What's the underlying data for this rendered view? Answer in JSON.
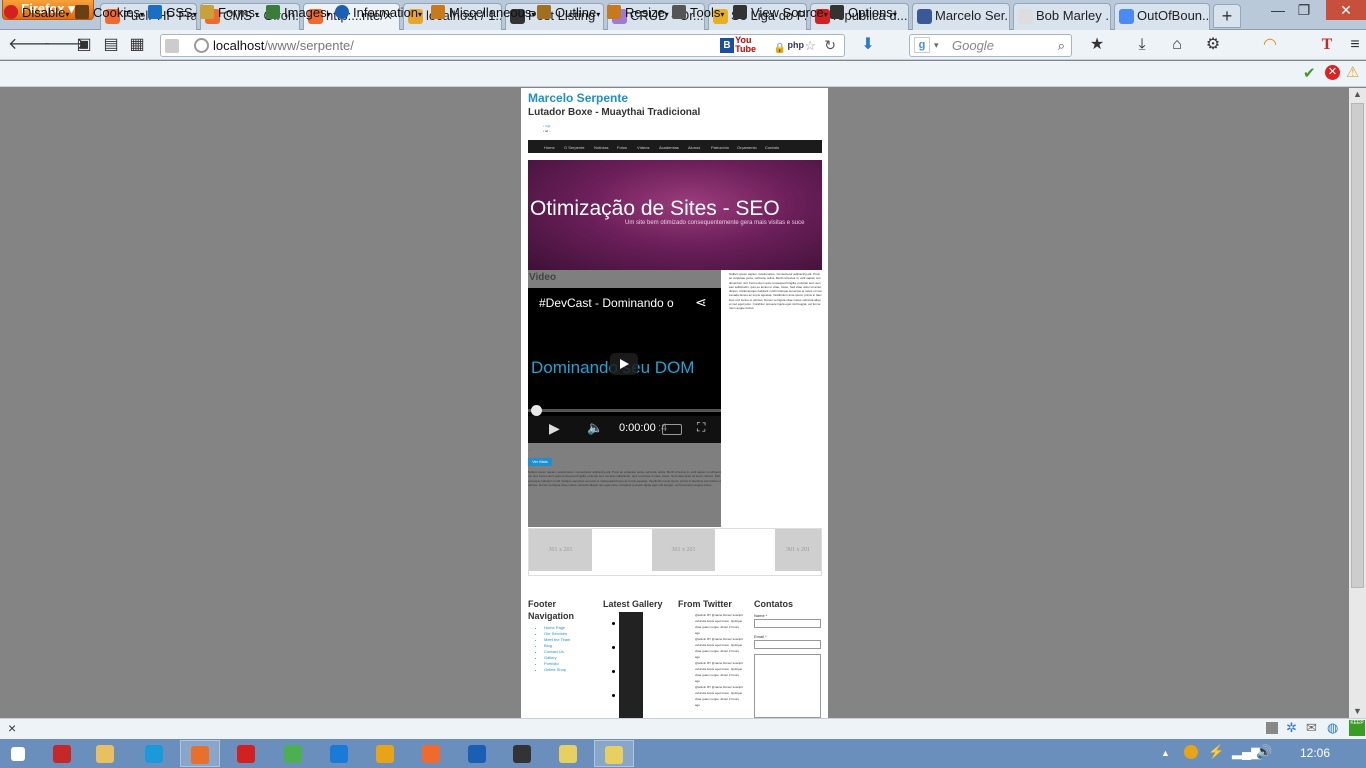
{
  "browser": {
    "app_button": "Firefox",
    "tabs": [
      {
        "label": "FuelPHP Fra...",
        "icon": "xampp-icon",
        "color": "#f06a2d"
      },
      {
        "label": "CMS - Giroh...",
        "icon": "xampp-icon",
        "color": "#f06a2d"
      },
      {
        "label": "http:...nte/",
        "icon": "xampp-icon",
        "color": "#f06a2d",
        "active": true
      },
      {
        "label": "localhost / 1...",
        "icon": "phpmyadmin-icon",
        "color": "#e7a52a"
      },
      {
        "label": "Post Listing",
        "icon": "codepen-icon",
        "color": "#333333"
      },
      {
        "label": "CRUD - Or...",
        "icon": "drop-icon",
        "color": "#9c7ad6"
      },
      {
        "label": "Se Liga do P...",
        "icon": "bird-icon",
        "color": "#e8b020"
      },
      {
        "label": "republica d...",
        "icon": "youtube-icon",
        "color": "#d32020"
      },
      {
        "label": "Marcelo Ser...",
        "icon": "facebook-icon",
        "color": "#3b5998"
      },
      {
        "label": "Bob Marley ...",
        "icon": "page-icon",
        "color": "#dddddd"
      },
      {
        "label": "OutOfBoun...",
        "icon": "google-icon",
        "color": "#4a8af4"
      }
    ],
    "url_host": "localhost",
    "url_path": "/www/serpente/",
    "search_engine": "Google",
    "search_placeholder": "Google"
  },
  "webdev_toolbar": [
    {
      "label": "Disable",
      "icon": "disable-icon"
    },
    {
      "label": "Cookies",
      "icon": "cookies-icon"
    },
    {
      "label": "CSS",
      "icon": "css-icon"
    },
    {
      "label": "Forms",
      "icon": "forms-icon"
    },
    {
      "label": "Images",
      "icon": "images-icon"
    },
    {
      "label": "Information",
      "icon": "information-icon"
    },
    {
      "label": "Miscellaneous",
      "icon": "miscellaneous-icon"
    },
    {
      "label": "Outline",
      "icon": "outline-icon"
    },
    {
      "label": "Resize",
      "icon": "resize-icon"
    },
    {
      "label": "Tools",
      "icon": "tools-icon"
    },
    {
      "label": "View Source",
      "icon": "view-source-icon"
    },
    {
      "label": "Options",
      "icon": "options-icon"
    }
  ],
  "site": {
    "title": "Marcelo Serpente",
    "subtitle": "Lutador Boxe - Muaythai Tradicional",
    "contact_lines": [
      "m@...",
      "tel ..."
    ],
    "nav": [
      "Home",
      "O Serpente",
      "Notícias",
      "Fotos",
      "Vídeos",
      "Academias",
      "Alunos",
      "Patrocínio",
      "Orçamento",
      "Contato"
    ],
    "banner_title": "Otimização de Sites - SEO",
    "banner_sub": "Um site bem otimizado consequentemente gera mais visitas e suce",
    "video_heading": "Video",
    "video_title": "#DevCast - Dominando o",
    "video_overlay": "Dominando seu DOM",
    "video_time": "0:00:00",
    "video_duration": ":4",
    "more_button": "Ver Mais",
    "lorem": "Nullam ipsum sapien, iaculis lacus, Consectetur adipiscing elit. Proin ac vulputate porta, vehicula, tellus. Morbi id lectus in, velit sapien condimentum nisl. Fermentum quis consequat fringilla, pulvinar sed. Aenean sollicitudin, quis eu lectus ut vitae, fusce. Sed vitae dolor sit amet, dictum. Pellentesque habitant morbi tristique senectus et netus et malesuada fames ac turpis egestas. Vestibulum ante ipsum primis in faucibus orci luctus et ultrices. Donec vel ligula vitae metus vehicula aliquet nec eget justo. Curabitur posuere ligula eget nisl feugiat, vel fermentum augue luctus.",
    "thumbs": [
      "301 x 201",
      "301 x 201",
      "301 x 201"
    ],
    "footer": {
      "nav_title": "Footer Navigation",
      "nav_links": [
        "Home Page",
        "Our Services",
        "Meet the Team",
        "Blog",
        "Contact Us",
        "Gallery",
        "Portfolio",
        "Online Shop"
      ],
      "gallery_title": "Latest Gallery",
      "twitter_title": "From Twitter",
      "tweets": [
        "@admin RT @name Donec suscipit vehicula turpis eget lorem. Quisque vitae quam neque. about 2 hours ago",
        "@admin RT @name Donec suscipit vehicula turpis eget lorem. Quisque vitae quam neque. about 2 hours ago",
        "@admin RT @name Donec suscipit vehicula turpis eget lorem. Quisque vitae quam neque. about 2 hours ago",
        "@admin RT @name Donec suscipit vehicula turpis eget lorem. Quisque vitae quam neque. about 2 hours ago"
      ],
      "contact_title": "Contatos",
      "name_label": "Name *",
      "email_label": "Email *"
    }
  },
  "status": {
    "close_symbol": "×",
    "clock": "12:06"
  }
}
